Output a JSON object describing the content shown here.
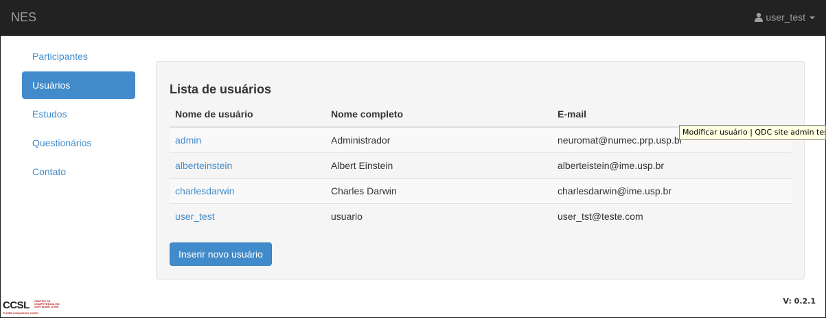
{
  "navbar": {
    "brand": "NES",
    "username": "user_test"
  },
  "sidebar": {
    "items": [
      {
        "label": "Participantes",
        "active": false
      },
      {
        "label": "Usuários",
        "active": true
      },
      {
        "label": "Estudos",
        "active": false
      },
      {
        "label": "Questionários",
        "active": false
      },
      {
        "label": "Contato",
        "active": false
      }
    ]
  },
  "main": {
    "title": "Lista de usuários",
    "columns": [
      "Nome de usuário",
      "Nome completo",
      "E-mail"
    ],
    "rows": [
      {
        "username": "admin",
        "fullname": "Administrador",
        "email": "neuromat@numec.prp.usp.br"
      },
      {
        "username": "alberteinstein",
        "fullname": "Albert Einstein",
        "email": "alberteistein@ime.usp.br"
      },
      {
        "username": "charlesdarwin",
        "fullname": "Charles Darwin",
        "email": "charlesdarwin@ime.usp.br"
      },
      {
        "username": "user_test",
        "fullname": "usuario",
        "email": "user_tst@teste.com"
      }
    ],
    "add_button": "Inserir novo usuário"
  },
  "tooltip": "Modificar usuário | QDC site admin test",
  "footer": {
    "logo_main": "CCSL",
    "logo_sub": "CENTRO DE COMPETÊNCIA EM SOFTWARE LIVRE",
    "logo_tag": "FLOSS Competence Center",
    "version": "V: 0.2.1"
  },
  "colors": {
    "navbar_bg": "#222222",
    "accent": "#428bca",
    "panel_bg": "#f5f5f5"
  }
}
